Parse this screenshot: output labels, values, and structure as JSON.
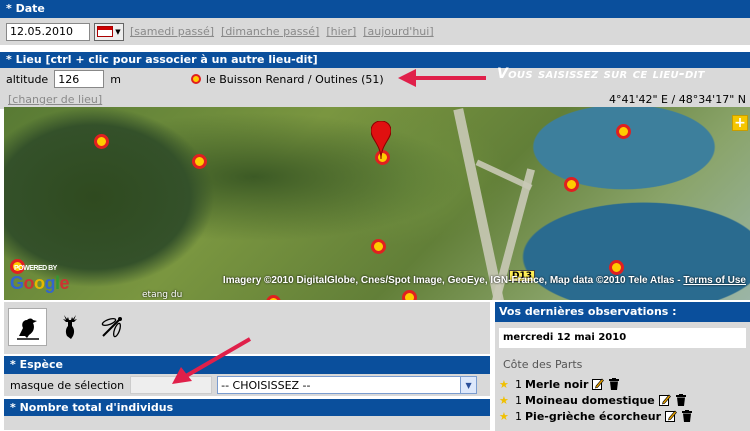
{
  "date_section": {
    "header": "* Date",
    "date_value": "12.05.2010",
    "shortcuts": [
      "[samedi passé]",
      "[dimanche passé]",
      "[hier]",
      "[aujourd'hui]"
    ]
  },
  "lieu_section": {
    "header": "* Lieu [ctrl + clic pour associer à un autre lieu-dit]",
    "altitude_label": "altitude",
    "altitude_value": "126",
    "altitude_unit": "m",
    "place_name": "le Buisson Renard / Outines (51)",
    "annotation": "Vous saisissez sur ce lieu-dit",
    "change_link": "[changer de lieu]",
    "coordinates": "4°41'42\" E / 48°34'17\" N"
  },
  "map": {
    "copyright": "Imagery ©2010 DigitalGlobe, Cnes/Spot Image, GeoEye, IGN-France, Map data ©2010 Tele Atlas -",
    "terms_link": "Terms of Use",
    "logo": "Google",
    "powered_by": "POWERED BY",
    "place_label": "etang du",
    "road_badge": "D13",
    "zoom_in": "+"
  },
  "categories": {
    "icons": [
      "bird-icon",
      "deer-icon",
      "dragonfly-icon"
    ]
  },
  "espece_section": {
    "header": "* Espèce",
    "mask_label": "masque de sélection",
    "mask_value": "",
    "select_value": "-- CHOISISSEZ --"
  },
  "total_section": {
    "header": "* Nombre total d'individus"
  },
  "observations": {
    "header": "Vos dernières observations :",
    "date": "mercredi 12 mai 2010",
    "place": "Côte des Parts",
    "items": [
      {
        "count": "1",
        "name": "Merle noir"
      },
      {
        "count": "1",
        "name": "Moineau domestique"
      },
      {
        "count": "1",
        "name": "Pie-grièche écorcheur"
      }
    ]
  },
  "colors": {
    "header_blue": "#0a4f9c",
    "panel_grey": "#d9d9d9",
    "marker_fill": "#ffcc00",
    "marker_border": "#e02020",
    "annotation_arrow": "#e0204a"
  }
}
